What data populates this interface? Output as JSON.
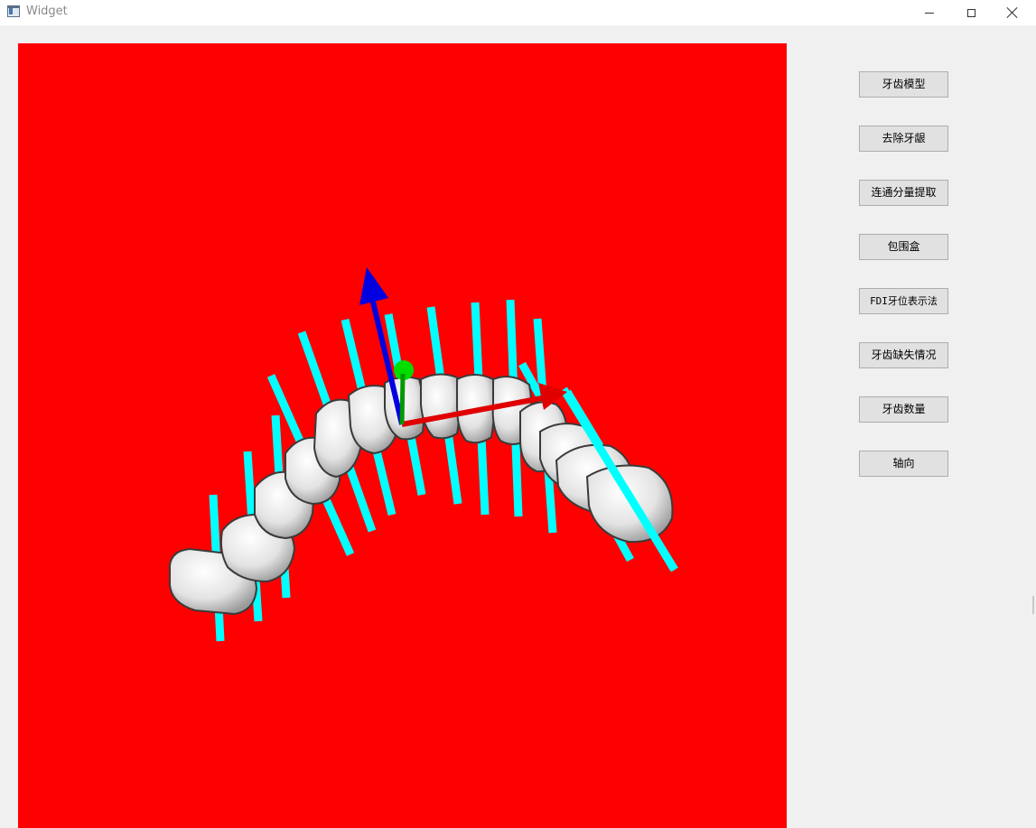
{
  "window": {
    "title": "Widget",
    "controls": {
      "minimize": "minimize",
      "maximize": "maximize",
      "close": "close"
    }
  },
  "viewport": {
    "background_color": "#ff0000",
    "scene": "3D dental arch model with tooth axis lines and coordinate axes",
    "colors": {
      "axis_lines": "#00ffff",
      "x_axis": "#e00000",
      "y_axis": "#0000e0",
      "z_axis": "#00c000",
      "teeth": "#e8e8e8"
    }
  },
  "buttons": [
    {
      "label": "牙齿模型"
    },
    {
      "label": "去除牙龈"
    },
    {
      "label": "连通分量提取"
    },
    {
      "label": "包围盒"
    },
    {
      "label": "FDI牙位表示法"
    },
    {
      "label": "牙齿缺失情况"
    },
    {
      "label": "牙齿数量"
    },
    {
      "label": "轴向"
    }
  ]
}
